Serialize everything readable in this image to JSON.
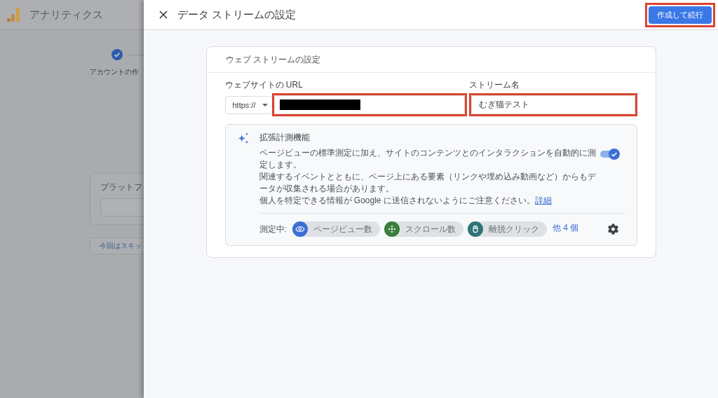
{
  "background_page": {
    "app_name": "アナリティクス",
    "steps": [
      {
        "label": "アカウントの作",
        "completed": true
      }
    ],
    "platform_card": {
      "title": "プラットフ"
    },
    "skip_button": "今回はスキッ"
  },
  "dialog": {
    "title": "データ ストリームの設定",
    "primary_button": {
      "label": "作成して続行",
      "highlighted": true
    }
  },
  "stream_card": {
    "title": "ウェブ ストリームの設定",
    "url_field": {
      "label": "ウェブサイトの URL",
      "protocol": "https://",
      "value_redacted": true,
      "highlighted": true
    },
    "name_field": {
      "label": "ストリーム名",
      "value": "むぎ猫テスト",
      "highlighted": true
    }
  },
  "enhanced_measurement": {
    "title": "拡張計測機能",
    "description": [
      "ページビューの標準測定に加え、サイトのコンテンツとのインタラクションを自動的に測定します。",
      "関連するイベントとともに、ページ上にある要素（リンクや埋め込み動画など）からもデータが収集される場合があります。",
      "個人を特定できる情報が Google に送信されないようにご注意ください。"
    ],
    "details_link": "詳細",
    "enabled": true,
    "measuring_label": "測定中:",
    "metrics": [
      {
        "kind": "page_views",
        "label": "ページビュー数",
        "color": "#3b6fd6"
      },
      {
        "kind": "scroll",
        "label": "スクロール数",
        "color": "#3a7d3c"
      },
      {
        "kind": "outbound_click",
        "label": "離脱クリック",
        "color": "#2e7478"
      }
    ],
    "more_link": "他 4 個"
  }
}
